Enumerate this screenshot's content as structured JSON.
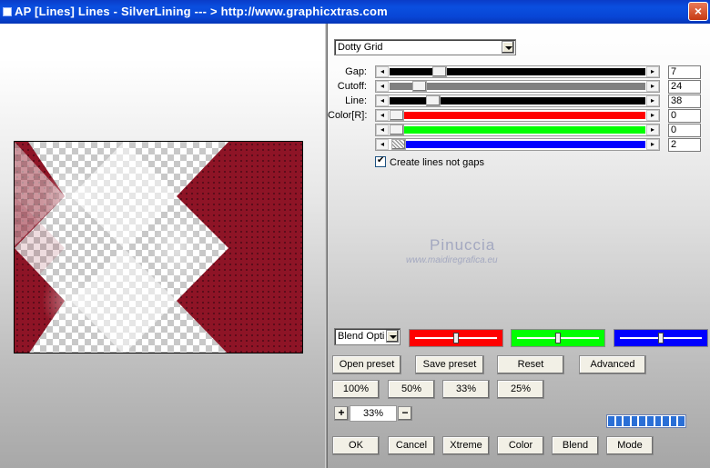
{
  "window": {
    "title": "AP [Lines]  Lines - SilverLining     --- > http://www.graphicxtras.com",
    "close_label": "×"
  },
  "preset_select": {
    "value": "Dotty Grid"
  },
  "sliders": [
    {
      "label": "Gap:",
      "value": "7",
      "fill": "#000000",
      "position": 0.16
    },
    {
      "label": "Cutoff:",
      "value": "24",
      "fill": "#808080",
      "position": 0.1
    },
    {
      "label": "Line:",
      "value": "38",
      "fill": "#000000",
      "position": 0.16
    },
    {
      "label": "Color[R]:",
      "value": "0",
      "fill": "#ff0000",
      "position": 0.0
    },
    {
      "label": "",
      "value": "0",
      "fill": "#00ff00",
      "position": 0.0
    },
    {
      "label": "",
      "value": "2",
      "fill": "#0000ff",
      "position": 0.01
    }
  ],
  "checkbox": {
    "label": "Create lines not gaps",
    "checked": true
  },
  "watermark": {
    "line1": "Pinuccia",
    "line2": "www.maidiregrafica.eu"
  },
  "blend_select": {
    "value": "Blend Opti"
  },
  "color_boxes": [
    {
      "name": "red",
      "color": "#ff0000",
      "position": 0.5
    },
    {
      "name": "green",
      "color": "#00ff00",
      "position": 0.5
    },
    {
      "name": "blue",
      "color": "#0000ff",
      "position": 0.5
    }
  ],
  "buttons_row1": [
    "Open preset",
    "Save preset",
    "Reset",
    "Advanced"
  ],
  "buttons_zoom": [
    "100%",
    "50%",
    "33%",
    "25%"
  ],
  "zoom": {
    "plus": "+",
    "minus": "−",
    "value": "33%"
  },
  "progress_segments": 10,
  "buttons_bottom": [
    "OK",
    "Cancel",
    "Xtreme",
    "Color",
    "Blend",
    "Mode"
  ],
  "colors": {
    "preview_red": "#8e1426",
    "titlebar": "#0a4fe0"
  }
}
